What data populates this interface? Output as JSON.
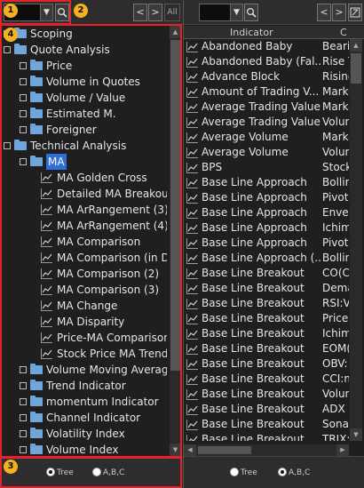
{
  "markers": [
    "1",
    "2",
    "3",
    "4"
  ],
  "toolbar": {
    "all_label": "All",
    "combo_arrow": "▼",
    "search_icon": "search-icon",
    "prev_label": "<",
    "next_label": ">"
  },
  "tree": {
    "items": [
      {
        "label": "Scoping",
        "type": "folder",
        "level": 0,
        "expander": true
      },
      {
        "label": "Quote Analysis",
        "type": "folder",
        "level": 0,
        "expander": true
      },
      {
        "label": "Price",
        "type": "folder",
        "level": 1,
        "expander": true
      },
      {
        "label": "Volume in Quotes",
        "type": "folder",
        "level": 1,
        "expander": true
      },
      {
        "label": "Volume / Value",
        "type": "folder",
        "level": 1,
        "expander": true
      },
      {
        "label": "Estimated M.",
        "type": "folder",
        "level": 1,
        "expander": true
      },
      {
        "label": "Foreigner",
        "type": "folder",
        "level": 1,
        "expander": true
      },
      {
        "label": "Technical Analysis",
        "type": "folder",
        "level": 0,
        "expander": true
      },
      {
        "label": "MA",
        "type": "folder",
        "level": 1,
        "expander": true,
        "selected": true
      },
      {
        "label": "MA Golden Cross",
        "type": "chart",
        "level": 2
      },
      {
        "label": "Detailed MA Breakout",
        "type": "chart",
        "level": 2
      },
      {
        "label": "MA ArRangement (3)",
        "type": "chart",
        "level": 2
      },
      {
        "label": "MA ArRangement (4)",
        "type": "chart",
        "level": 2
      },
      {
        "label": "MA Comparison",
        "type": "chart",
        "level": 2
      },
      {
        "label": "MA Comparison (in D",
        "type": "chart",
        "level": 2
      },
      {
        "label": "MA Comparison (2)",
        "type": "chart",
        "level": 2
      },
      {
        "label": "MA Comparison (3)",
        "type": "chart",
        "level": 2
      },
      {
        "label": "MA Change",
        "type": "chart",
        "level": 2
      },
      {
        "label": "MA Disparity",
        "type": "chart",
        "level": 2
      },
      {
        "label": "Price-MA Comparison",
        "type": "chart",
        "level": 2
      },
      {
        "label": "Stock Price MA Trend",
        "type": "chart",
        "level": 2
      },
      {
        "label": "Volume Moving Average",
        "type": "folder",
        "level": 1,
        "expander": true
      },
      {
        "label": "Trend Indicator",
        "type": "folder",
        "level": 1,
        "expander": true
      },
      {
        "label": "momentum Indicator",
        "type": "folder",
        "level": 1,
        "expander": true
      },
      {
        "label": "Channel Indicator",
        "type": "folder",
        "level": 1,
        "expander": true
      },
      {
        "label": "Volatility Index",
        "type": "folder",
        "level": 1,
        "expander": true
      },
      {
        "label": "Volume Index",
        "type": "folder",
        "level": 1,
        "expander": true
      }
    ]
  },
  "footer": {
    "options": [
      {
        "label": "Tree",
        "selected": true
      },
      {
        "label": "A,B,C",
        "selected": false
      }
    ]
  },
  "right_footer": {
    "options": [
      {
        "label": "Tree",
        "selected": false
      },
      {
        "label": "A,B,C",
        "selected": true
      }
    ]
  },
  "table": {
    "headers": [
      "Indicator",
      "C"
    ],
    "rows": [
      [
        "Abandoned Baby",
        "Bearis"
      ],
      [
        "Abandoned Baby (Fal...",
        "Rise T"
      ],
      [
        "Advance Block",
        "Rising"
      ],
      [
        "Amount of Trading V...",
        "Marke"
      ],
      [
        "Average Trading Value",
        "Marke"
      ],
      [
        "Average Trading Value",
        "Volun"
      ],
      [
        "Average Volume",
        "Marke"
      ],
      [
        "Average Volume",
        "Volun"
      ],
      [
        "BPS",
        "Stock"
      ],
      [
        "Base Line Approach",
        "Bollin"
      ],
      [
        "Base Line Approach",
        "Pivot:"
      ],
      [
        "Base Line Approach",
        "Envel"
      ],
      [
        "Base Line Approach",
        "Ichim"
      ],
      [
        "Base Line Approach",
        "Pivot"
      ],
      [
        "Base Line Approach (...",
        "Bollin"
      ],
      [
        "Base Line Breakout",
        "CO(C"
      ],
      [
        "Base Line Breakout",
        "Dema"
      ],
      [
        "Base Line Breakout",
        "RSI:V"
      ],
      [
        "Base Line Breakout",
        "Price"
      ],
      [
        "Base Line Breakout",
        "Ichim"
      ],
      [
        "Base Line Breakout",
        "EOM("
      ],
      [
        "Base Line Breakout",
        "OBV:"
      ],
      [
        "Base Line Breakout",
        "CCI:m"
      ],
      [
        "Base Line Breakout",
        "Volun"
      ],
      [
        "Base Line Breakout",
        "ADX I"
      ],
      [
        "Base Line Breakout",
        "Sonar"
      ],
      [
        "Base Line Breakout",
        "TRIX:"
      ]
    ]
  }
}
